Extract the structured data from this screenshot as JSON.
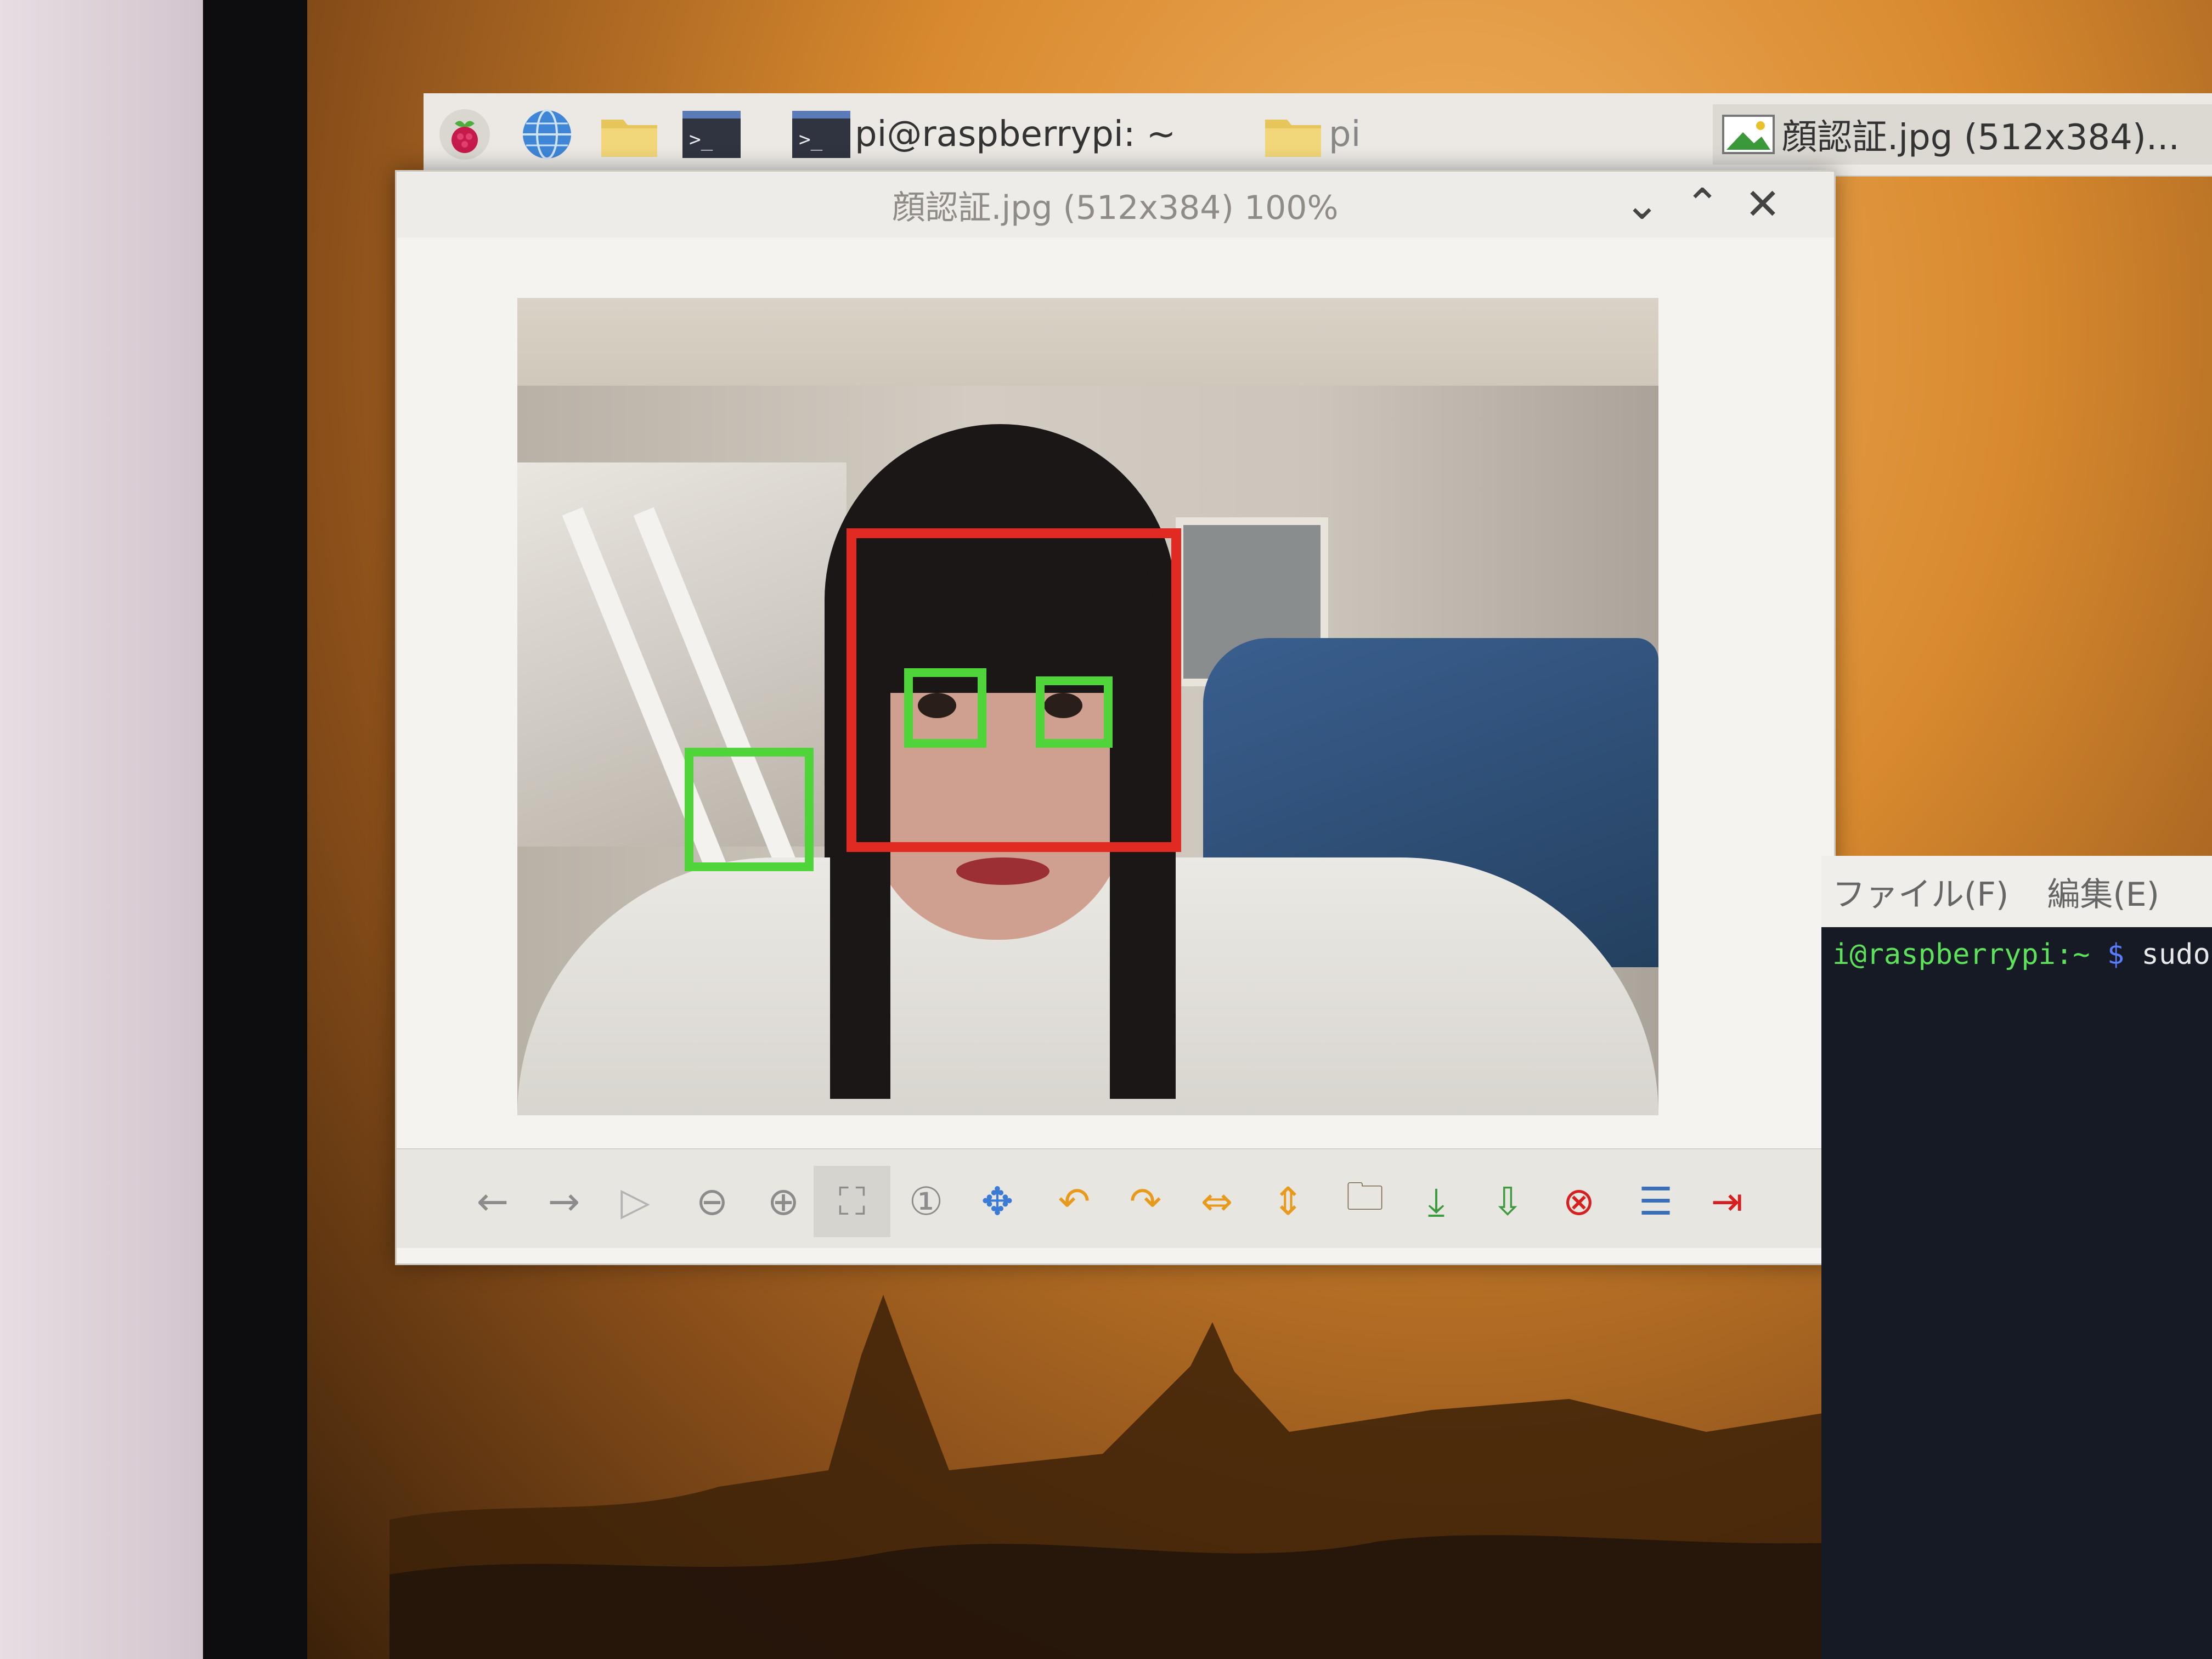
{
  "taskbar": {
    "terminal_label": "pi@raspberrypi: ~",
    "folder_label": "pi",
    "viewer_task_label": "顔認証.jpg (512x384)..."
  },
  "viewer": {
    "title": "顔認証.jpg (512x384) 100%"
  },
  "terminal": {
    "menu_file": "ファイル(F)",
    "menu_edit": "編集(E)",
    "prompt_user": "i@raspberrypi:~",
    "prompt_symbol": "$",
    "command": "sudo"
  },
  "colors": {
    "face_box": "#e02a22",
    "eye_box": "#4fd43a",
    "prompt_green": "#5ee15a",
    "prompt_blue": "#5a7cff"
  },
  "icons": {
    "menu": "raspberry-icon",
    "browser": "globe-icon",
    "files": "folder-icon",
    "terminal": "terminal-icon"
  }
}
